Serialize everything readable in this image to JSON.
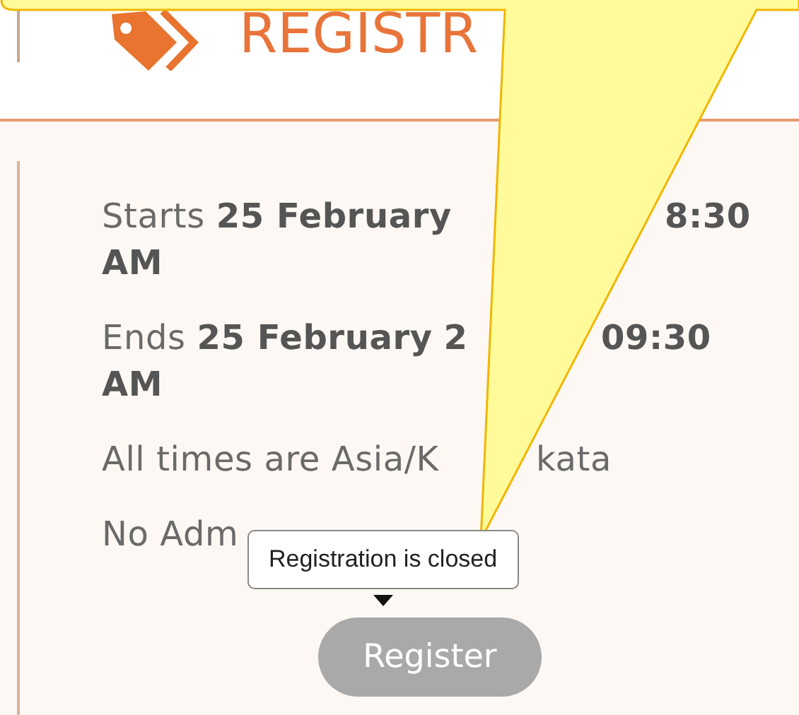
{
  "heading": {
    "title": "REGISTR"
  },
  "details": [
    {
      "left": "Starts **25 February**",
      "right": "**8:30**",
      "continuation": "**AM**"
    },
    {
      "left": "Ends **25 February** **2**",
      "right": "**09:30**",
      "continuation": "**AM**"
    },
    {
      "left": "All times are Asia/K",
      "right": "kata"
    },
    {
      "left": "No Adm"
    }
  ],
  "tooltip": {
    "text": "Registration is closed"
  },
  "register_button": {
    "label": "Register",
    "disabled": true
  }
}
